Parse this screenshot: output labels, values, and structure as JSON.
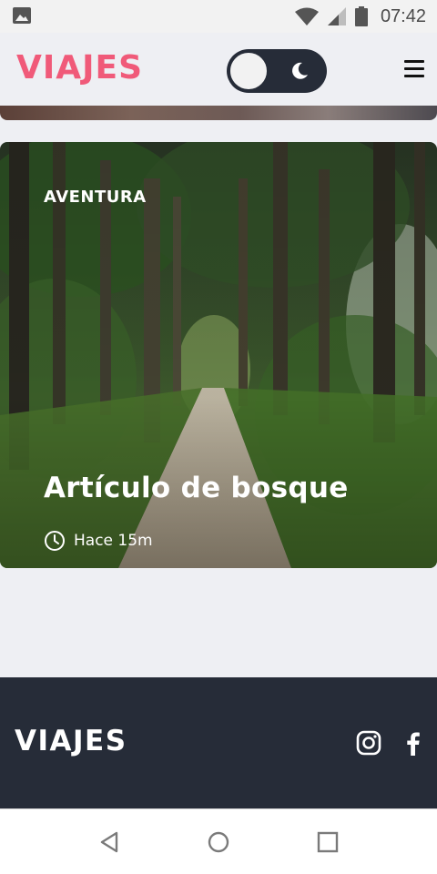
{
  "status_bar": {
    "time": "07:42",
    "icons": [
      "image-icon",
      "wifi-icon",
      "signal-icon",
      "battery-icon"
    ]
  },
  "header": {
    "brand": "VIAJES",
    "brand_color": "#f05a79",
    "theme_toggle": {
      "state": "light",
      "icon": "moon-icon"
    },
    "menu_icon": "hamburger-menu-icon"
  },
  "card": {
    "category": "AVENTURA",
    "title": "Artículo de bosque",
    "time_label": "Hace 15m",
    "time_icon": "clock-icon"
  },
  "footer": {
    "brand": "VIAJES",
    "social": [
      "instagram-icon",
      "facebook-icon"
    ],
    "background": "#262c38"
  },
  "nav_bar": {
    "buttons": [
      "back-icon",
      "home-icon",
      "recents-icon"
    ]
  }
}
